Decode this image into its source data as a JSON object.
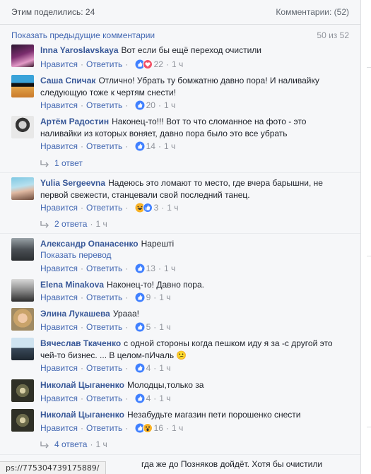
{
  "header": {
    "shares": "Этим поделились: 24",
    "comments": "Комментарии: (52)"
  },
  "prev": {
    "label": "Показать предыдущие комментарии",
    "count": "50 из 52"
  },
  "actions": {
    "like": "Нравится",
    "reply": "Ответить",
    "sep": "·"
  },
  "comments": [
    {
      "author": "Inna Yaroslavskaya",
      "text": "Вот если бы ещё переход очистили",
      "reactions": "like,love",
      "count": "22",
      "time": "1 ч"
    },
    {
      "author": "Саша Спичак",
      "text": "Отлично! Убрать ту бомжатню давно пора! И наливайку следующую тоже к чертям снести!",
      "reactions": "like",
      "count": "20",
      "time": "1 ч"
    },
    {
      "author": "Артём Радостин",
      "text": "Наконец-то!!! Вот то что сломанное на фото - это наливайки из которых воняет, давно пора было это все убрать",
      "reactions": "like",
      "count": "14",
      "time": "1 ч"
    },
    {
      "author": "Yulia Sergeevna",
      "text": "Надеюсь это ломают то место, где вчера барышни, не первой свежести, станцевали свой последний танец.",
      "reactions": "haha,like",
      "count": "3",
      "time": "1 ч"
    },
    {
      "author": "Александр Опанасенко",
      "text": "Нарешті",
      "translate": "Показать перевод",
      "reactions": "like",
      "count": "13",
      "time": "1 ч"
    },
    {
      "author": "Elena Minakova",
      "text": "Наконец-то! Давно пора.",
      "reactions": "like",
      "count": "9",
      "time": "1 ч"
    },
    {
      "author": "Элина Лукашева",
      "text": "Урааа!",
      "reactions": "like",
      "count": "5",
      "time": "1 ч"
    },
    {
      "author": "Вячеслав Ткаченко",
      "text": "с одной стороны когда пешком иду я за -с другой это чей-то бизнес. ... В целом-пИчаль 😕",
      "reactions": "like",
      "count": "4",
      "time": "1 ч"
    },
    {
      "author": "Николай Цыганенко",
      "text": "Молодцы,только за",
      "reactions": "like",
      "count": "4",
      "time": "1 ч"
    },
    {
      "author": "Николай Цыганенко",
      "text": "Незабудьте магазин пети порошенко снести",
      "reactions": "like,wow",
      "count": "16",
      "time": "1 ч"
    }
  ],
  "replies": [
    {
      "label": "1 ответ",
      "time": ""
    },
    {
      "label": "2 ответа",
      "time": "1 ч"
    },
    {
      "label": "4 ответа",
      "time": "1 ч"
    }
  ],
  "cutoff_text": "гда же до Позняков дойдёт. Хотя бы очистили",
  "status_url": "ps://775304739175889/",
  "colors": {
    "link": "#4267b2",
    "author": "#385898",
    "like": "#4080ff",
    "love": "#f25268",
    "haha": "#f7b125"
  }
}
